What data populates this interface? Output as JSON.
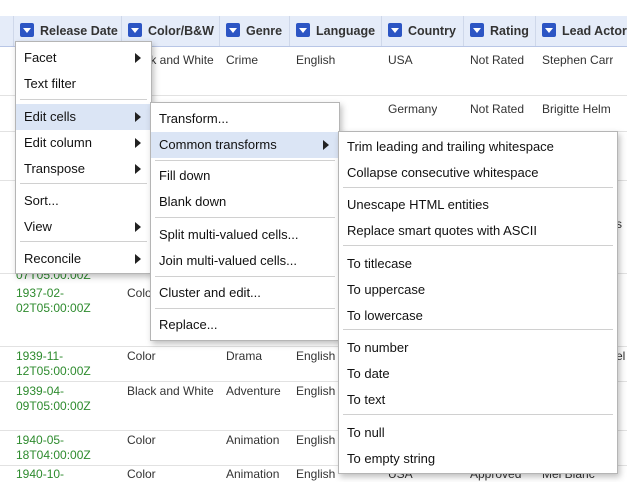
{
  "columns": {
    "release_date": "Release Date",
    "color_bw": "Color/B&W",
    "genre": "Genre",
    "language": "Language",
    "country": "Country",
    "rating": "Rating",
    "lead_actor": "Lead Actor"
  },
  "rows": [
    {
      "color": "Black and White",
      "genre": "Crime",
      "language": "English",
      "country": "USA",
      "rating": "Not Rated",
      "actor": "Stephen Carr"
    },
    {
      "color": "",
      "genre": "",
      "language": "",
      "country": "Germany",
      "rating": "Not Rated",
      "actor": "Brigitte Helm"
    },
    {
      "date1": "1937-02-",
      "date2": "02T05:00:00Z",
      "date_partial": "07T05:00:00Z",
      "color": "Color"
    },
    {
      "date1": "1939-11-",
      "date2": "12T05:00:00Z",
      "color": "Color",
      "genre": "Drama",
      "language": "English",
      "actor": "el"
    },
    {
      "date1": "1939-04-",
      "date2": "09T05:00:00Z",
      "color": "Black and White",
      "genre": "Adventure",
      "language": "English"
    },
    {
      "date1": "1940-05-",
      "date2": "18T04:00:00Z",
      "color": "Color",
      "genre": "Animation",
      "language": "English"
    },
    {
      "date1": "1940-10-",
      "color": "Color",
      "genre": "Animation",
      "language": "English",
      "country": "USA",
      "rating": "Approved",
      "actor": "Mel Blanc"
    }
  ],
  "menu1": {
    "facet": "Facet",
    "text_filter": "Text filter",
    "edit_cells": "Edit cells",
    "edit_column": "Edit column",
    "transpose": "Transpose",
    "sort": "Sort...",
    "view": "View",
    "reconcile": "Reconcile"
  },
  "menu2": {
    "transform": "Transform...",
    "common_transforms": "Common transforms",
    "fill_down": "Fill down",
    "blank_down": "Blank down",
    "split": "Split multi-valued cells...",
    "join": "Join multi-valued cells...",
    "cluster": "Cluster and edit...",
    "replace": "Replace..."
  },
  "menu3": {
    "trim": "Trim leading and trailing whitespace",
    "collapse": "Collapse consecutive whitespace",
    "unescape": "Unescape HTML entities",
    "smart_quotes": "Replace smart quotes with ASCII",
    "titlecase": "To titlecase",
    "uppercase": "To uppercase",
    "lowercase": "To lowercase",
    "number": "To number",
    "date": "To date",
    "text": "To text",
    "null": "To null",
    "empty": "To empty string"
  },
  "overflow_text": "s"
}
